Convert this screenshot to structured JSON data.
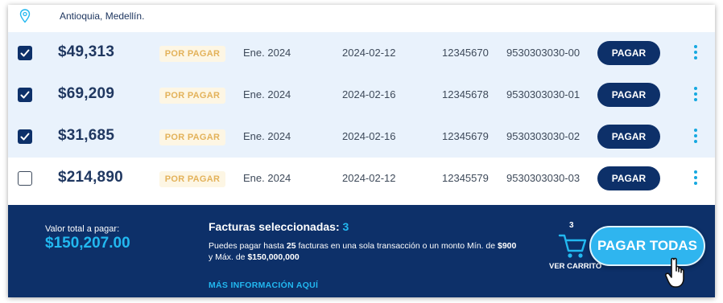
{
  "location": {
    "text": "Antioquia, Medellín."
  },
  "invoices": [
    {
      "selected": true,
      "amount": "$49,313",
      "status": "POR PAGAR",
      "period": "Ene. 2024",
      "date": "2024-02-12",
      "number": "12345670",
      "reference": "9530303030-00",
      "pay_label": "PAGAR"
    },
    {
      "selected": true,
      "amount": "$69,209",
      "status": "POR PAGAR",
      "period": "Ene. 2024",
      "date": "2024-02-16",
      "number": "12345678",
      "reference": "9530303030-01",
      "pay_label": "PAGAR"
    },
    {
      "selected": true,
      "amount": "$31,685",
      "status": "POR PAGAR",
      "period": "Ene. 2024",
      "date": "2024-02-16",
      "number": "12345679",
      "reference": "9530303030-02",
      "pay_label": "PAGAR"
    },
    {
      "selected": false,
      "amount": "$214,890",
      "status": "POR PAGAR",
      "period": "Ene. 2024",
      "date": "2024-02-12",
      "number": "12345579",
      "reference": "9530303030-03",
      "pay_label": "PAGAR"
    }
  ],
  "footer": {
    "total_label": "Valor total a pagar:",
    "total_value": "$150,207.00",
    "selected_label": "Facturas seleccionadas:",
    "selected_count": "3",
    "info_part1": "Puedes pagar hasta ",
    "info_max_invoices": "25",
    "info_part2": " facturas en una sola transacción o un monto Mín. de ",
    "info_min_amount": "$900",
    "info_part3": " y Máx. de ",
    "info_max_amount": "$150,000,000",
    "more_info_link": "MÁS INFORMACIÓN AQUÍ",
    "cart_count": "3",
    "cart_label": "VER CARRITO",
    "pay_all_label": "PAGAR TODAS"
  },
  "colors": {
    "navy": "#0d3069",
    "accent_blue": "#22b8f0",
    "selected_row_bg": "#e9f2fc",
    "badge_bg": "#fdf6e4",
    "badge_text": "#e3b25a"
  },
  "icons": {
    "location": "location-pin-icon",
    "row_menu": "kebab-menu-icon",
    "cart": "shopping-cart-icon",
    "cursor": "hand-pointer-icon"
  }
}
